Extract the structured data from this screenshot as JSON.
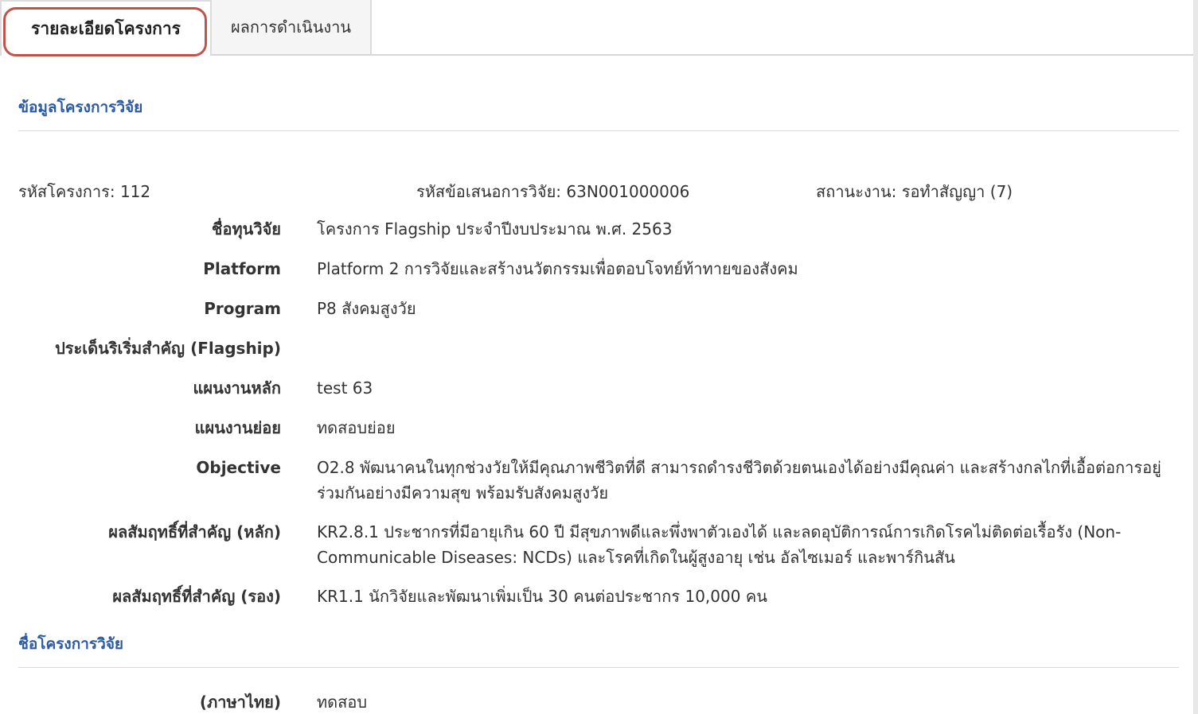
{
  "tabs": [
    {
      "label": "รายละเอียดโครงการ",
      "active": true
    },
    {
      "label": "ผลการดำเนินงาน",
      "active": false
    }
  ],
  "section_project_info": {
    "title": "ข้อมูลโครงการวิจัย"
  },
  "summary": {
    "project_code": "รหัสโครงการ: 112",
    "proposal_code": "รหัสข้อเสนอการวิจัย: 63N001000006",
    "status": "สถานะงาน: รอทำสัญญา (7)"
  },
  "details": [
    {
      "label": "ชื่อทุนวิจัย",
      "value": "โครงการ Flagship ประจำปีงบประมาณ พ.ศ. 2563"
    },
    {
      "label": "Platform",
      "value": "Platform 2 การวิจัยและสร้างนวัตกรรมเพื่อตอบโจทย์ท้าทายของสังคม"
    },
    {
      "label": "Program",
      "value": "P8 สังคมสูงวัย"
    },
    {
      "label": "ประเด็นริเริ่มสำคัญ (Flagship)",
      "value": ""
    },
    {
      "label": "แผนงานหลัก",
      "value": "test 63"
    },
    {
      "label": "แผนงานย่อย",
      "value": "ทดสอบย่อย"
    },
    {
      "label": "Objective",
      "value": "O2.8 พัฒนาคนในทุกช่วงวัยให้มีคุณภาพชีวิตที่ดี สามารถดำรงชีวิตด้วยตนเองได้อย่างมีคุณค่า และสร้างกลไกที่เอื้อต่อการอยู่ร่วมกันอย่างมีความสุข พร้อมรับสังคมสูงวัย"
    },
    {
      "label": "ผลสัมฤทธิ์ที่สำคัญ (หลัก)",
      "value": "KR2.8.1 ประชากรที่มีอายุเกิน 60 ปี มีสุขภาพดีและพึ่งพาตัวเองได้ และลดอุบัติการณ์การเกิดโรคไม่ติดต่อเรื้อรัง (Non-Communicable Diseases: NCDs) และโรคที่เกิดในผู้สูงอายุ เช่น อัลไซเมอร์ และพาร์กินสัน"
    },
    {
      "label": "ผลสัมฤทธิ์ที่สำคัญ (รอง)",
      "value": "KR1.1 นักวิจัยและพัฒนาเพิ่มเป็น 30 คนต่อประชากร 10,000 คน"
    }
  ],
  "section_project_name": {
    "title": "ชื่อโครงการวิจัย"
  },
  "project_name": {
    "thai_label": "(ภาษาไทย)",
    "thai_value": "ทดสอบ"
  }
}
